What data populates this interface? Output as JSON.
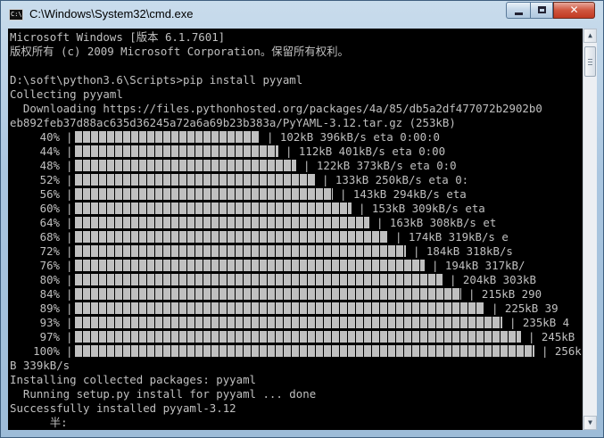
{
  "window": {
    "title": "C:\\Windows\\System32\\cmd.exe",
    "icon": "cmd-icon",
    "controls": [
      "minimize-icon",
      "maximize-icon",
      "close-icon"
    ]
  },
  "console": {
    "lines": [
      "Microsoft Windows [版本 6.1.7601]",
      "版权所有 (c) 2009 Microsoft Corporation。保留所有权利。",
      "",
      "D:\\soft\\python3.6\\Scripts>pip install pyyaml",
      "Collecting pyyaml",
      "  Downloading https://files.pythonhosted.org/packages/4a/85/db5a2df477072b2902b0",
      "eb892feb37d88ac635d36245a72a6a69b23b383a/PyYAML-3.12.tar.gz (253kB)"
    ],
    "progress_rows": [
      {
        "pct": "40%",
        "fraction": 0.4,
        "tail": "| 102kB 396kB/s eta 0:00:0"
      },
      {
        "pct": "44%",
        "fraction": 0.44,
        "tail": "| 112kB 401kB/s eta 0:00"
      },
      {
        "pct": "48%",
        "fraction": 0.48,
        "tail": "| 122kB 373kB/s eta 0:0"
      },
      {
        "pct": "52%",
        "fraction": 0.52,
        "tail": "| 133kB 250kB/s eta 0:"
      },
      {
        "pct": "56%",
        "fraction": 0.56,
        "tail": "| 143kB 294kB/s eta"
      },
      {
        "pct": "60%",
        "fraction": 0.6,
        "tail": "| 153kB 309kB/s eta"
      },
      {
        "pct": "64%",
        "fraction": 0.64,
        "tail": "| 163kB 308kB/s et"
      },
      {
        "pct": "68%",
        "fraction": 0.68,
        "tail": "| 174kB 319kB/s e"
      },
      {
        "pct": "72%",
        "fraction": 0.72,
        "tail": "| 184kB 318kB/s"
      },
      {
        "pct": "76%",
        "fraction": 0.76,
        "tail": "| 194kB 317kB/"
      },
      {
        "pct": "80%",
        "fraction": 0.8,
        "tail": "| 204kB 303kB"
      },
      {
        "pct": "84%",
        "fraction": 0.84,
        "tail": "| 215kB 290"
      },
      {
        "pct": "89%",
        "fraction": 0.89,
        "tail": "| 225kB 39"
      },
      {
        "pct": "93%",
        "fraction": 0.93,
        "tail": "| 235kB 4"
      },
      {
        "pct": "97%",
        "fraction": 0.97,
        "tail": "| 245kB"
      },
      {
        "pct": "100%",
        "fraction": 1.0,
        "tail": "| 256k"
      }
    ],
    "after_lines": [
      "B 339kB/s",
      "Installing collected packages: pyyaml",
      "  Running setup.py install for pyyaml ... done",
      "Successfully installed pyyaml-3.12",
      "      半:"
    ]
  },
  "colors": {
    "console_bg": "#000000",
    "console_fg": "#c0c0c0"
  }
}
